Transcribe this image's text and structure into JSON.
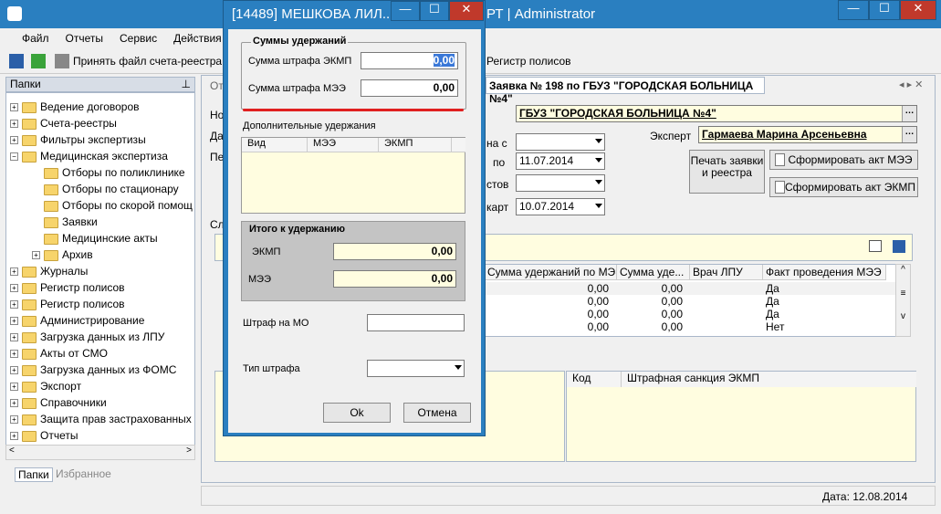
{
  "window": {
    "title": "РТ | Administrator"
  },
  "menu": [
    "Файл",
    "Отчеты",
    "Сервис",
    "Действия"
  ],
  "toolbar": {
    "accept_invoice": "Принять файл счета-реестра",
    "policy_register": "Регистр полисов"
  },
  "folders": {
    "header": "Папки",
    "items": [
      {
        "label": "Ведение договоров",
        "expandable": true,
        "level": 0
      },
      {
        "label": "Счета-реестры",
        "expandable": true,
        "level": 0
      },
      {
        "label": "Фильтры экспертизы",
        "expandable": true,
        "level": 0
      },
      {
        "label": "Медицинская экспертиза",
        "expandable": true,
        "level": 0,
        "expanded": true
      },
      {
        "label": "Отборы по поликлинике",
        "expandable": false,
        "level": 1
      },
      {
        "label": "Отборы по стационару",
        "expandable": false,
        "level": 1
      },
      {
        "label": "Отборы по скорой помощ",
        "expandable": false,
        "level": 1
      },
      {
        "label": "Заявки",
        "expandable": false,
        "level": 1
      },
      {
        "label": "Медицинские акты",
        "expandable": false,
        "level": 1
      },
      {
        "label": "Архив",
        "expandable": true,
        "level": 1
      },
      {
        "label": "Журналы",
        "expandable": true,
        "level": 0
      },
      {
        "label": "Регистр полисов",
        "expandable": true,
        "level": 0
      },
      {
        "label": "Регистр полисов",
        "expandable": true,
        "level": 0
      },
      {
        "label": "Администрирование",
        "expandable": true,
        "level": 0
      },
      {
        "label": "Загрузка данных из ЛПУ",
        "expandable": true,
        "level": 0
      },
      {
        "label": "Акты от СМО",
        "expandable": true,
        "level": 0
      },
      {
        "label": "Загрузка данных из ФОМС",
        "expandable": true,
        "level": 0
      },
      {
        "label": "Экспорт",
        "expandable": true,
        "level": 0
      },
      {
        "label": "Справочники",
        "expandable": true,
        "level": 0
      },
      {
        "label": "Защита прав застрахованных",
        "expandable": true,
        "level": 0
      },
      {
        "label": "Отчеты",
        "expandable": true,
        "level": 0
      }
    ],
    "tabs": [
      "Папки",
      "Избранное"
    ]
  },
  "document": {
    "tab_title": "Заявка № 198 по ГБУЗ \"ГОРОДСКАЯ БОЛЬНИЦА №4\"",
    "partial_labels": {
      "n": "Но",
      "d": "Да",
      "p": "Пе",
      "c": "Сл",
      "ot": "От"
    },
    "lpu": "ГБУЗ \"ГОРОДСКАЯ БОЛЬНИЦА №4\"",
    "expert_label": "Эксперт",
    "expert": "Гармаева Марина Арсеньевна",
    "date_from_label": "на с",
    "date_to_label": "по",
    "date_to": "11.07.2014",
    "status_label": "стов",
    "start_label": "карт",
    "start_date": "10.07.2014",
    "print_button": "Печать заявки и реестра",
    "act_mee_button": "Сформировать акт МЭЭ",
    "act_ekmp_button": "Сформировать акт ЭКМП",
    "grid_headers": [
      "Сумма удержаний по МЭЭ",
      "Сумма уде...",
      "Врач ЛПУ",
      "Факт проведения МЭЭ"
    ],
    "grid_rows": [
      {
        "mee": "0,00",
        "ud": "0,00",
        "fact": "Да"
      },
      {
        "mee": "0,00",
        "ud": "0,00",
        "fact": "Да"
      },
      {
        "mee": "0,00",
        "ud": "0,00",
        "fact": "Да"
      },
      {
        "mee": "0,00",
        "ud": "0,00",
        "fact": "Нет"
      }
    ],
    "bottom_headers": [
      "Код",
      "Штрафная санкция ЭКМП"
    ]
  },
  "status": {
    "date": "Дата: 12.08.2014"
  },
  "dialog": {
    "title": "[14489] МЕШКОВА ЛИЛ...",
    "group_sums": "Суммы удержаний",
    "ekmp_fine_label": "Сумма штрафа ЭКМП",
    "ekmp_fine_value": "0,00",
    "mee_fine_label": "Сумма штрафа МЭЭ",
    "mee_fine_value": "0,00",
    "extra_label": "Дополнительные удержания",
    "extra_headers": [
      "Вид",
      "МЭЭ",
      "ЭКМП"
    ],
    "group_total": "Итого к удержанию",
    "total_ekmp_label": "ЭКМП",
    "total_ekmp_value": "0,00",
    "total_mee_label": "МЭЭ",
    "total_mee_value": "0,00",
    "mo_fine_label": "Штраф на МО",
    "fine_type_label": "Тип штрафа",
    "ok": "Ok",
    "cancel": "Отмена"
  }
}
